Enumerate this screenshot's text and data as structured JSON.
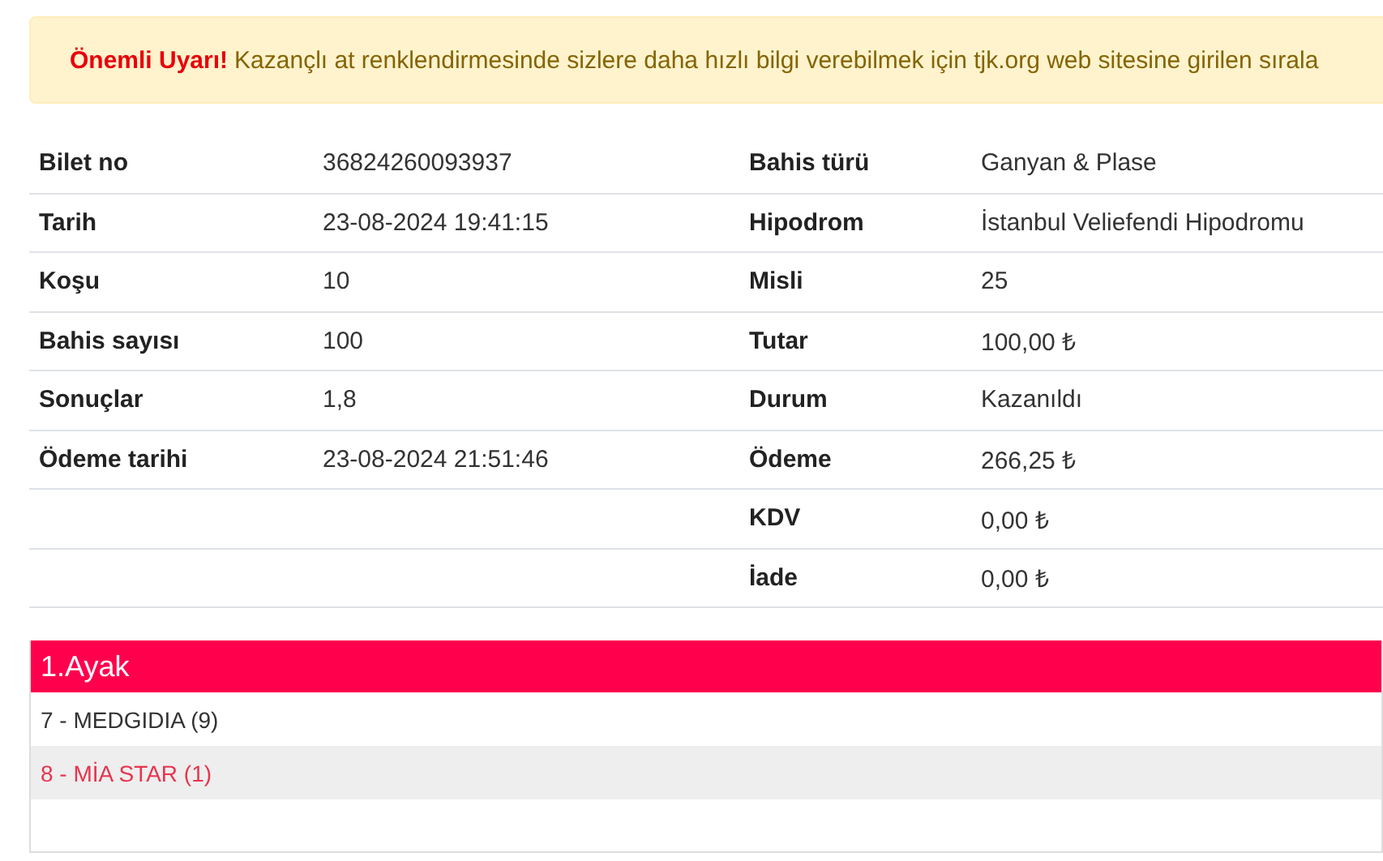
{
  "alert": {
    "title": "Önemli Uyarı!",
    "message": "Kazançlı at renklendirmesinde sizlere daha hızlı bilgi verebilmek için tjk.org web sitesine girilen sırala"
  },
  "details": [
    {
      "left_label": "Bilet no",
      "left_value": "36824260093937",
      "right_label": "Bahis türü",
      "right_value": "Ganyan & Plase"
    },
    {
      "left_label": "Tarih",
      "left_value": "23-08-2024 19:41:15",
      "right_label": "Hipodrom",
      "right_value": "İstanbul Veliefendi Hipodromu"
    },
    {
      "left_label": "Koşu",
      "left_value": "10",
      "right_label": "Misli",
      "right_value": "25"
    },
    {
      "left_label": "Bahis sayısı",
      "left_value": "100",
      "right_label": "Tutar",
      "right_value": "100,00 ₺"
    },
    {
      "left_label": "Sonuçlar",
      "left_value": "1,8",
      "right_label": "Durum",
      "right_value": "Kazanıldı"
    },
    {
      "left_label": "Ödeme tarihi",
      "left_value": "23-08-2024 21:51:46",
      "right_label": "Ödeme",
      "right_value": "266,25 ₺"
    },
    {
      "right_label": "KDV",
      "right_value": "0,00 ₺"
    },
    {
      "right_label": "İade",
      "right_value": "0,00 ₺"
    }
  ],
  "leg": {
    "title": "1.Ayak",
    "horses": [
      {
        "label": "7 - MEDGIDIA (9)",
        "highlighted": false
      },
      {
        "label": "8 - MİA STAR (1)",
        "highlighted": true
      }
    ]
  }
}
